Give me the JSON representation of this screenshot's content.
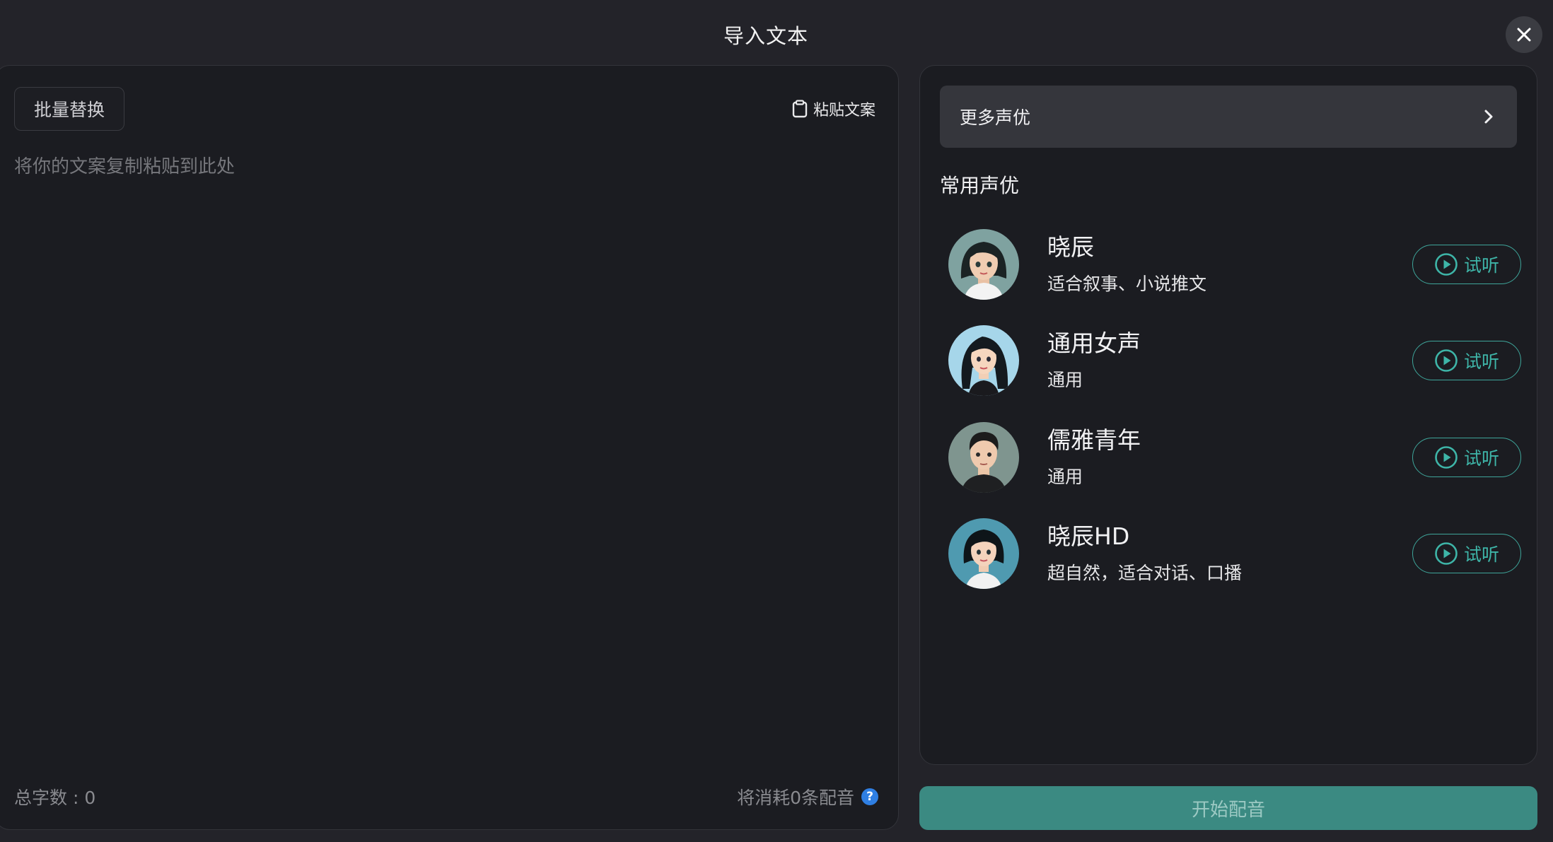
{
  "header": {
    "title": "导入文本"
  },
  "left": {
    "batch_replace_label": "批量替换",
    "paste_label": "粘贴文案",
    "textarea_placeholder": "将你的文案复制粘贴到此处",
    "word_count_label": "总字数 : 0",
    "consume_label": "将消耗0条配音"
  },
  "right": {
    "more_voices_label": "更多声优",
    "section_title": "常用声优",
    "voices": [
      {
        "name": "晓辰",
        "desc": "适合叙事、小说推文",
        "listen": "试听"
      },
      {
        "name": "通用女声",
        "desc": "通用",
        "listen": "试听"
      },
      {
        "name": "儒雅青年",
        "desc": "通用",
        "listen": "试听"
      },
      {
        "name": "晓辰HD",
        "desc": "超自然，适合对话、口播",
        "listen": "试听"
      }
    ]
  },
  "footer": {
    "start_label": "开始配音"
  },
  "colors": {
    "accent": "#3eb5a8",
    "primary_button": "#3b8a82",
    "help": "#2f7fe3"
  }
}
